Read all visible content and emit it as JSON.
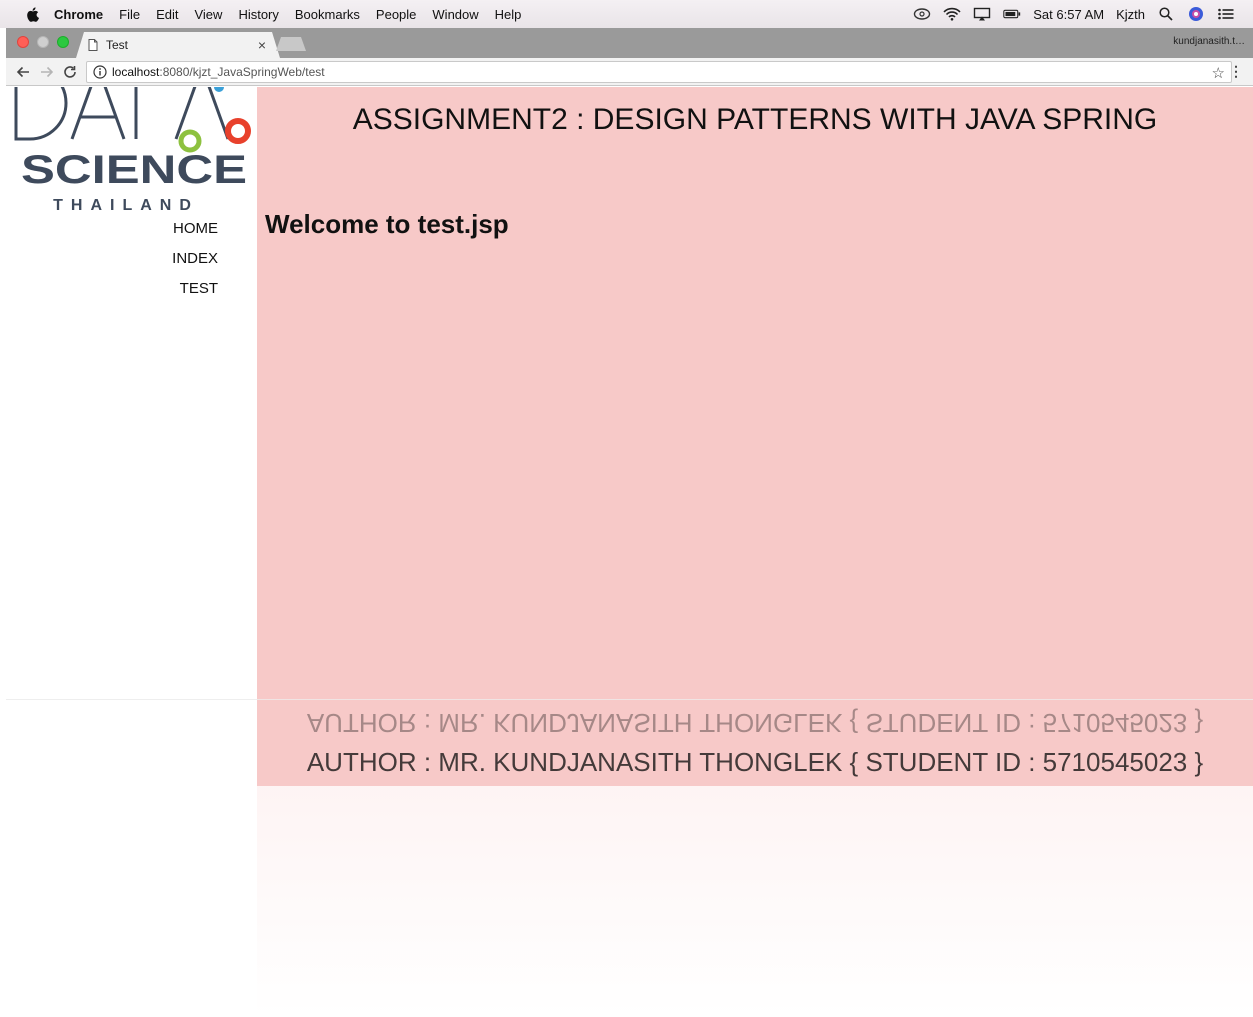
{
  "menubar": {
    "app_name": "Chrome",
    "items": [
      "File",
      "Edit",
      "View",
      "History",
      "Bookmarks",
      "People",
      "Window",
      "Help"
    ],
    "clock": "Sat 6:57 AM",
    "user": "Kjzth"
  },
  "tab": {
    "title": "Test",
    "close": "×",
    "profile": "kundjanasith.t…"
  },
  "toolbar": {
    "url_host": "localhost",
    "url_path": ":8080/kjzt_JavaSpringWeb/test",
    "star": "☆",
    "menu": "⋮"
  },
  "sidebar": {
    "logo_words": [
      "DATA",
      "SCIENCE",
      "THAILAND"
    ],
    "nav": [
      "HOME",
      "INDEX",
      "TEST"
    ]
  },
  "main": {
    "title": "ASSIGNMENT2 : DESIGN PATTERNS WITH JAVA SPRING",
    "welcome": "Welcome to test.jsp",
    "author": "AUTHOR : MR. KUNDJANASITH THONGLEK { STUDENT ID : 5710545023 }"
  },
  "colors": {
    "main_bg": "#f7c9c8",
    "logo_dark": "#3e4a5c",
    "logo_green": "#8dc13f",
    "logo_red": "#e8412c",
    "logo_blue": "#3aa0d8"
  }
}
